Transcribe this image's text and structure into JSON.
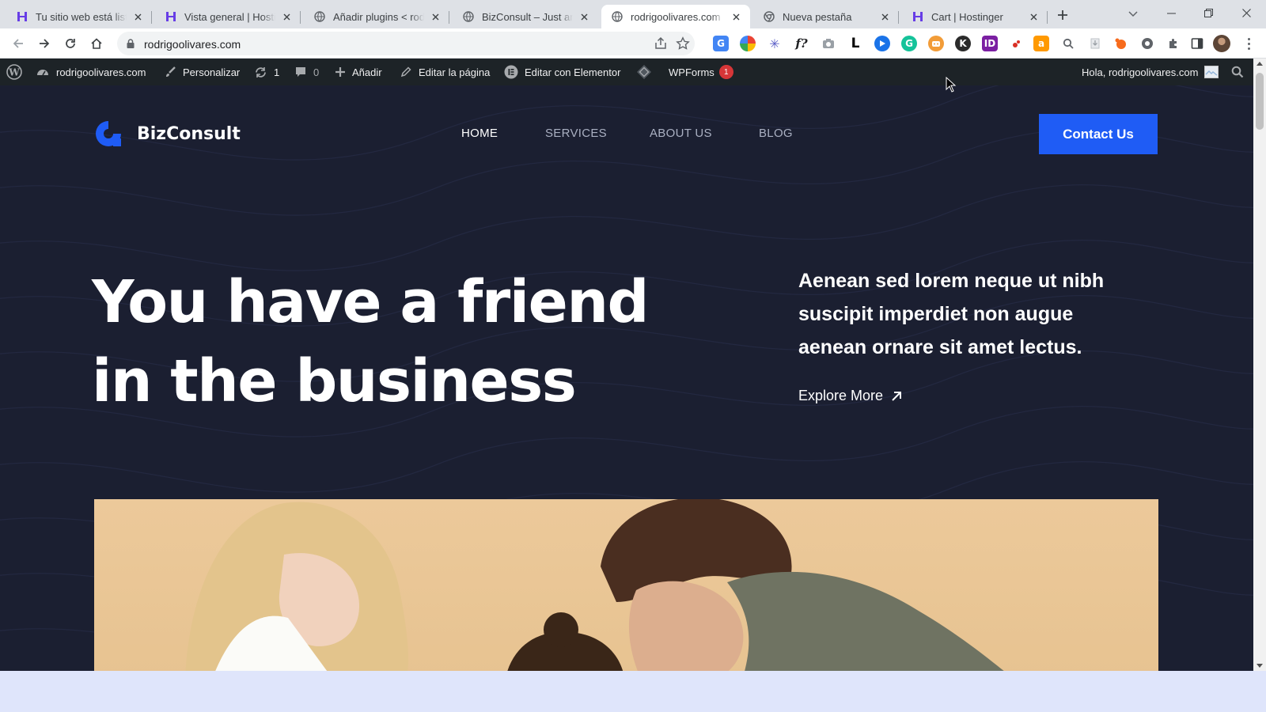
{
  "browser": {
    "tabs": [
      {
        "title": "Tu sitio web está listo",
        "favicon": "hostinger-icon"
      },
      {
        "title": "Vista general | Hostinger",
        "favicon": "hostinger-icon"
      },
      {
        "title": "Añadir plugins < rodrigoolivares.com",
        "favicon": "globe-icon"
      },
      {
        "title": "BizConsult – Just another WordPress site",
        "favicon": "globe-icon"
      },
      {
        "title": "rodrigoolivares.com",
        "favicon": "globe-icon",
        "active": true
      },
      {
        "title": "Nueva pestaña",
        "favicon": "chrome-icon"
      },
      {
        "title": "Cart | Hostinger",
        "favicon": "hostinger-icon"
      }
    ],
    "url": "rodrigoolivares.com"
  },
  "adminbar": {
    "site_name": "rodrigoolivares.com",
    "customize": "Personalizar",
    "updates_count": "1",
    "comments_count": "0",
    "new": "Añadir",
    "edit_page": "Editar la página",
    "edit_elementor": "Editar con Elementor",
    "wpforms": "WPForms",
    "wpforms_badge": "1",
    "greeting": "Hola, rodrigoolivares.com"
  },
  "site": {
    "logo_text": "BizConsult",
    "nav": [
      "HOME",
      "SERVICES",
      "ABOUT US",
      "BLOG"
    ],
    "cta": "Contact Us",
    "hero_line1": "You have a friend",
    "hero_line2": "in the business",
    "hero_paragraph": "Aenean sed lorem neque ut nibh suscipit imperdiet non augue aenean ornare sit amet lectus.",
    "explore": "Explore More"
  },
  "colors": {
    "site_bg": "#1b1f31",
    "accent_blue": "#1f5cf5",
    "adminbar_bg": "#1d2327",
    "photo_bg": "#ecc99a"
  }
}
